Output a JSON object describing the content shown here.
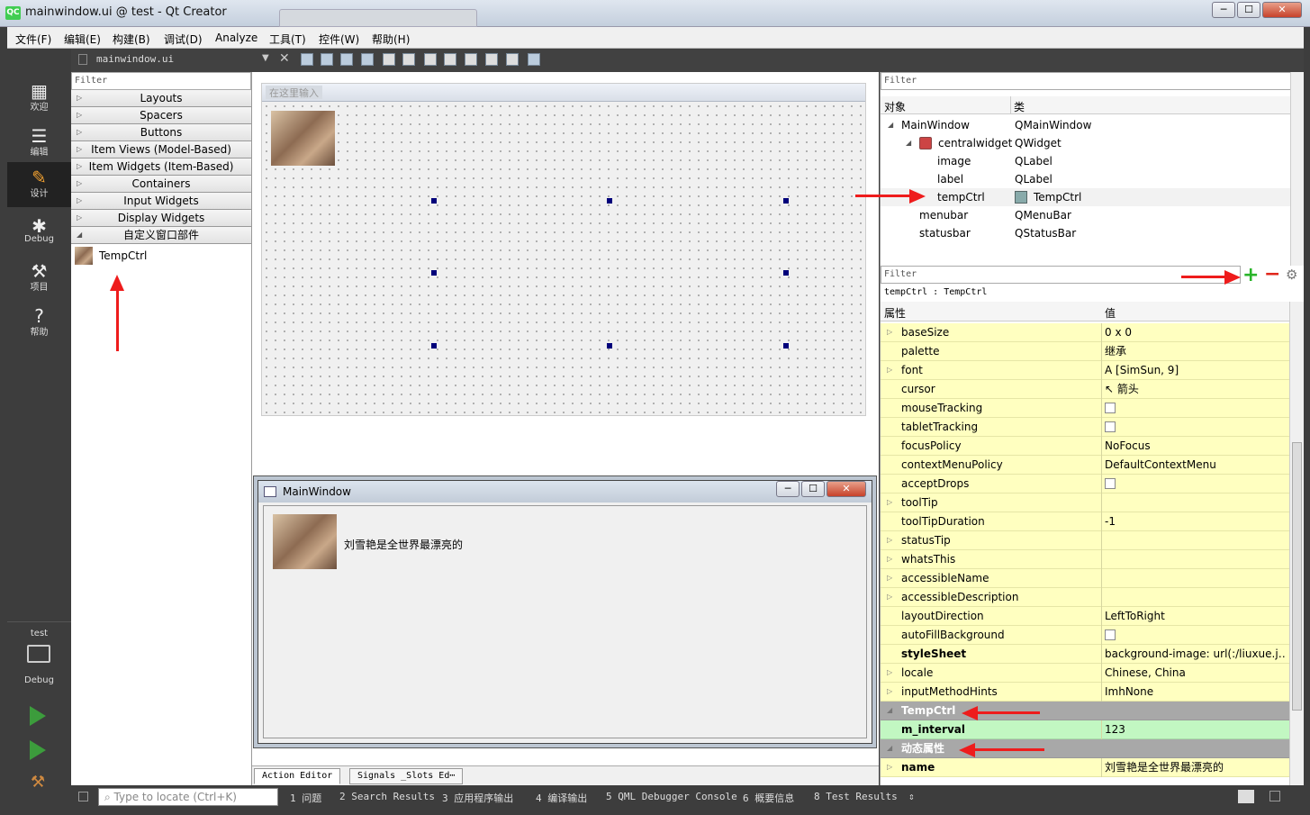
{
  "window": {
    "title": "mainwindow.ui @ test - Qt Creator",
    "qc_logo": "QC",
    "controls": [
      "─",
      "☐",
      "✕"
    ]
  },
  "menu": [
    "文件(F)",
    "编辑(E)",
    "构建(B)",
    "调试(D)",
    "Analyze",
    "工具(T)",
    "控件(W)",
    "帮助(H)"
  ],
  "modes": [
    {
      "icon": "grid-icon",
      "glyph": "▦",
      "label": "欢迎"
    },
    {
      "icon": "document-icon",
      "glyph": "☰",
      "label": "编辑"
    },
    {
      "icon": "pencil-icon",
      "glyph": "✎",
      "label": "设计"
    },
    {
      "icon": "bug-icon",
      "glyph": "✱",
      "label": "Debug"
    },
    {
      "icon": "wrench-icon",
      "glyph": "⚒",
      "label": "项目"
    },
    {
      "icon": "help-icon",
      "glyph": "?",
      "label": "帮助"
    }
  ],
  "kit": {
    "project": "test",
    "config": "Debug"
  },
  "editor": {
    "document": "mainwindow.ui"
  },
  "widgetbox": {
    "filter": "Filter",
    "categories": [
      "Layouts",
      "Spacers",
      "Buttons",
      "Item Views (Model-Based)",
      "Item Widgets (Item-Based)",
      "Containers",
      "Input Widgets",
      "Display Widgets",
      "自定义窗口部件"
    ],
    "custom_item": "TempCtrl"
  },
  "form": {
    "menu_placeholder": "在这里输入"
  },
  "preview": {
    "title": "MainWindow",
    "label_text": "刘雪艳是全世界最漂亮的"
  },
  "bottom_tabs": [
    "Action Editor",
    "Signals _Slots Ed⋯"
  ],
  "object_inspector": {
    "filter": "Filter",
    "col_object": "对象",
    "col_class": "类",
    "rows": [
      {
        "obj": "MainWindow",
        "cls": "QMainWindow",
        "depth": 0,
        "exp": "◢"
      },
      {
        "obj": "centralwidget",
        "cls": "QWidget",
        "depth": 1,
        "exp": "◢"
      },
      {
        "obj": "image",
        "cls": "QLabel",
        "depth": 2,
        "exp": ""
      },
      {
        "obj": "label",
        "cls": "QLabel",
        "depth": 2,
        "exp": ""
      },
      {
        "obj": "tempCtrl",
        "cls": "TempCtrl",
        "depth": 2,
        "exp": ""
      },
      {
        "obj": "menubar",
        "cls": "QMenuBar",
        "depth": 1,
        "exp": ""
      },
      {
        "obj": "statusbar",
        "cls": "QStatusBar",
        "depth": 1,
        "exp": ""
      }
    ]
  },
  "property_editor": {
    "filter": "Filter",
    "add_label": "+",
    "remove_label": "−",
    "wrench": "⚙",
    "context": "tempCtrl : TempCtrl",
    "col_prop": "属性",
    "col_value": "值",
    "rows": [
      {
        "k": "baseSize",
        "v": "0 x 0",
        "exp": true
      },
      {
        "k": "palette",
        "v": "继承"
      },
      {
        "k": "font",
        "v": "A  [SimSun, 9]",
        "exp": true
      },
      {
        "k": "cursor",
        "v": "↖  箭头"
      },
      {
        "k": "mouseTracking",
        "cb": true
      },
      {
        "k": "tabletTracking",
        "cb": true
      },
      {
        "k": "focusPolicy",
        "v": "NoFocus"
      },
      {
        "k": "contextMenuPolicy",
        "v": "DefaultContextMenu"
      },
      {
        "k": "acceptDrops",
        "cb": true
      },
      {
        "k": "toolTip",
        "v": "",
        "exp": true
      },
      {
        "k": "toolTipDuration",
        "v": "-1"
      },
      {
        "k": "statusTip",
        "v": "",
        "exp": true
      },
      {
        "k": "whatsThis",
        "v": "",
        "exp": true
      },
      {
        "k": "accessibleName",
        "v": "",
        "exp": true
      },
      {
        "k": "accessibleDescription",
        "v": "",
        "exp": true
      },
      {
        "k": "layoutDirection",
        "v": "LeftToRight"
      },
      {
        "k": "autoFillBackground",
        "cb": true
      },
      {
        "k": "styleSheet",
        "v": "background-image: url(:/liuxue.j…",
        "bold": true
      },
      {
        "k": "locale",
        "v": "Chinese, China",
        "exp": true
      },
      {
        "k": "inputMethodHints",
        "v": "ImhNone",
        "exp": true
      },
      {
        "k": "TempCtrl",
        "v": "",
        "grp": true
      },
      {
        "k": "m_interval",
        "v": "123",
        "green": true,
        "bold": true
      },
      {
        "k": "动态属性",
        "v": "",
        "grp": true
      },
      {
        "k": "name",
        "v": "刘雪艳是全世界最漂亮的",
        "bold": true,
        "exp": true,
        "blue": true
      }
    ]
  },
  "statusbar": {
    "locate_placeholder": "Type to locate (Ctrl+K)",
    "items": [
      "1  问题",
      "2  Search Results",
      "3  应用程序输出",
      "4  编译输出",
      "5  QML Debugger Console",
      "6  概要信息",
      "8  Test Results"
    ]
  },
  "colors": {
    "accent_red": "#ee1c1c",
    "prop_yellow": "#ffffc0",
    "prop_group": "#a8a8a8",
    "prop_green": "#c2f7c2",
    "handle": "#00007a"
  }
}
